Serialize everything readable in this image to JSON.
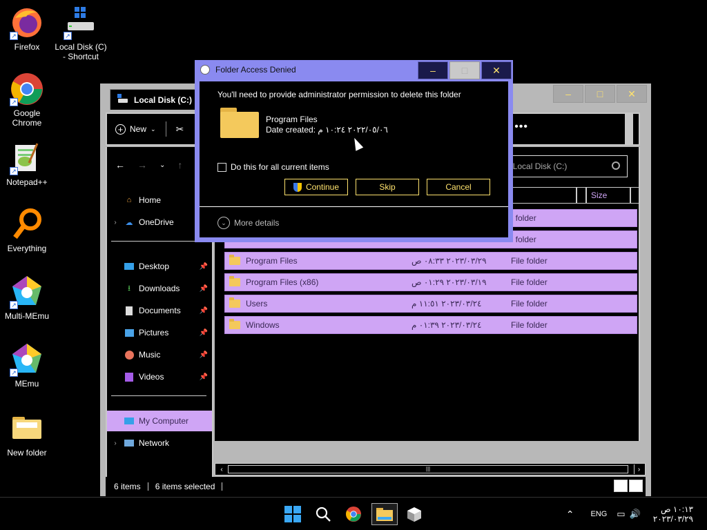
{
  "desktop": {
    "icons": [
      {
        "label": "Firefox",
        "icon": "firefox-icon"
      },
      {
        "label": "Local Disk (C)\n- Shortcut",
        "icon": "drive-icon"
      },
      {
        "label": "Google\nChrome",
        "icon": "chrome-icon"
      },
      {
        "label": "Notepad++",
        "icon": "notepad-icon"
      },
      {
        "label": "Everything",
        "icon": "search-icon"
      },
      {
        "label": "Multi-MEmu",
        "icon": "memu-icon"
      },
      {
        "label": "MEmu",
        "icon": "memu-icon"
      },
      {
        "label": "New folder",
        "icon": "folder-icon"
      }
    ]
  },
  "explorer": {
    "tab_title": "Local Disk (C:)",
    "new_label": "New",
    "search_placeholder": "arch Local Disk (C:)",
    "columns": {
      "type": "pe",
      "size": "Size"
    },
    "sidebar": {
      "home": "Home",
      "onedrive": "OneDrive",
      "desktop": "Desktop",
      "downloads": "Downloads",
      "documents": "Documents",
      "pictures": "Pictures",
      "music": "Music",
      "videos": "Videos",
      "mycomputer": "My Computer",
      "network": "Network"
    },
    "files": [
      {
        "name": "Program Files",
        "date": "٢٠٢٣/٠٣/٢٩ ٠٨:٣٣ ص",
        "type": "File folder"
      },
      {
        "name": "Program Files (x86)",
        "date": "٢٠٢٣/٠٣/١٩ ٠١:٢٩ ص",
        "type": "File folder"
      },
      {
        "name": "Users",
        "date": "٢٠٢٣/٠٣/٢٤ ١١:٥١ م",
        "type": "File folder"
      },
      {
        "name": "Windows",
        "date": "٢٠٢٣/٠٣/٢٤ ٠١:٣٩ م",
        "type": "File folder"
      }
    ],
    "hidden_row_types": [
      "File folder",
      "File folder"
    ],
    "status": {
      "items": "6 items",
      "selected": "6 items selected"
    }
  },
  "dialog": {
    "title": "Folder Access Denied",
    "message": "You'll need to provide administrator permission to delete this folder",
    "file_name": "Program Files",
    "date_label": "Date created: ",
    "date_value": "٢٠٢٢/٠٥/٠٦ ١٠:٢٤ م",
    "checkbox_label": "Do this for all current items",
    "continue_label": "Continue",
    "skip_label": "Skip",
    "cancel_label": "Cancel",
    "more_details": "More details"
  },
  "taskbar": {
    "language": "ENG",
    "time": "١٠:١٣ ص",
    "date": "٢٠٢٣/٠٣/٢٩"
  },
  "colors": {
    "selection": "#cfa5f5",
    "dialog_frame": "#8a8af0",
    "button_text": "#ffe36e"
  }
}
